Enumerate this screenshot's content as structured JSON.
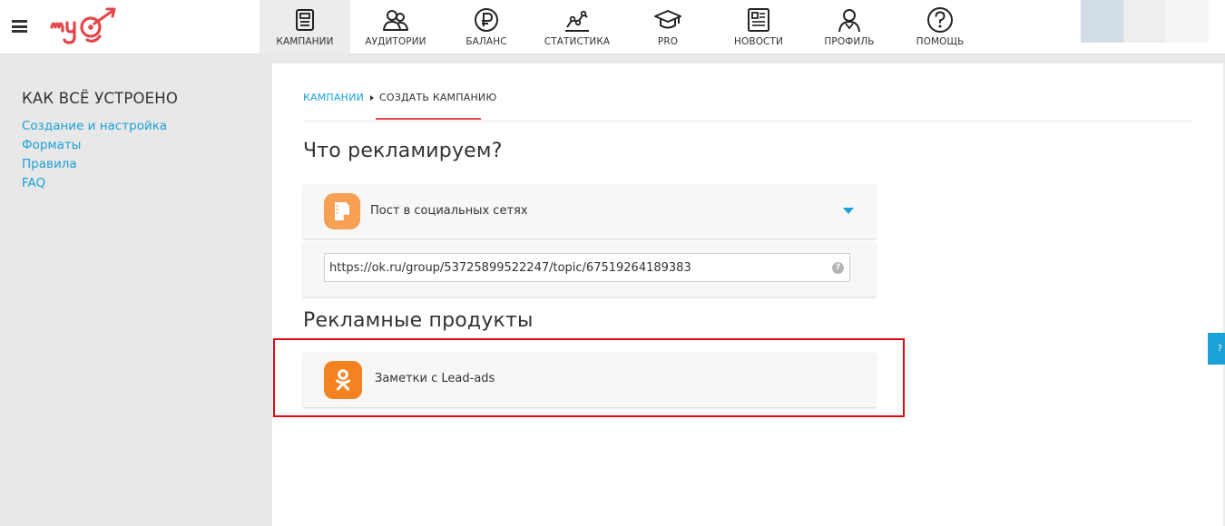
{
  "header": {
    "logo_text": "myTarget",
    "nav": [
      {
        "label": "КАМПАНИИ",
        "icon": "campaigns-icon",
        "active": true
      },
      {
        "label": "АУДИТОРИИ",
        "icon": "audiences-icon",
        "active": false
      },
      {
        "label": "БАЛАНС",
        "icon": "ruble-icon",
        "active": false
      },
      {
        "label": "СТАТИСТИКА",
        "icon": "statistics-icon",
        "active": false
      },
      {
        "label": "PRO",
        "icon": "graduation-cap-icon",
        "active": false
      },
      {
        "label": "НОВОСТИ",
        "icon": "news-icon",
        "active": false
      },
      {
        "label": "ПРОФИЛЬ",
        "icon": "profile-icon",
        "active": false
      },
      {
        "label": "ПОМОЩЬ",
        "icon": "help-icon",
        "active": false
      }
    ],
    "swatch_colors": [
      "#d3dde8",
      "#eeeeee",
      "#f5f5f5"
    ]
  },
  "sidebar": {
    "title": "КАК ВСЁ УСТРОЕНО",
    "links": [
      "Создание и настройка",
      "Форматы",
      "Правила",
      "FAQ"
    ]
  },
  "breadcrumb": {
    "parent": "КАМПАНИИ",
    "current": "СОЗДАТЬ КАМПАНИЮ"
  },
  "main": {
    "what_title": "Что рекламируем?",
    "object_type": "Пост в социальных сетях",
    "url_value": "https://ok.ru/group/53725899522247/topic/67519264189383",
    "url_help": "?",
    "products_title": "Рекламные продукты",
    "product_label": "Заметки с Lead-ads"
  },
  "side_tab_label": "?",
  "colors": {
    "accent_blue": "#1aa1d6",
    "brand_red": "#e2474a",
    "highlight_red": "#e30613",
    "post_orange": "#f5a052",
    "ok_orange": "#f58220"
  }
}
